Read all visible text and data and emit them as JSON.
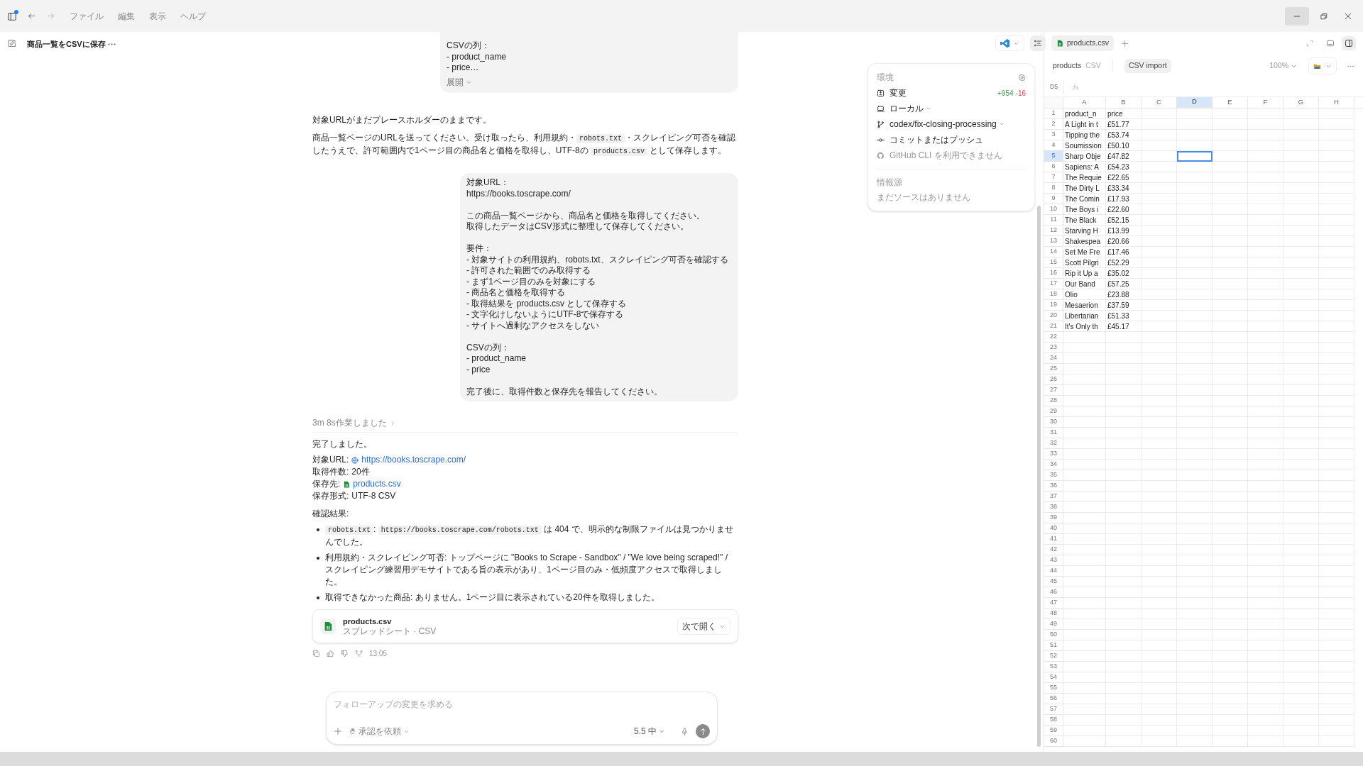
{
  "titlebar": {
    "menus": [
      "ファイル",
      "編集",
      "表示",
      "ヘルプ"
    ]
  },
  "thread": {
    "title": "商品一覧をCSVに保存"
  },
  "messages": [
    {
      "kind": "user",
      "paragraphs": [
        [
          "CSVの列：",
          "- product_name",
          "- price…"
        ]
      ],
      "expand_label": "展開"
    },
    {
      "kind": "assistant",
      "paragraphs": [
        [
          {
            "text": "対象URLがまだプレースホルダーのままです。"
          }
        ],
        [
          {
            "text": "商品一覧ページのURLを送ってください。受け取ったら、利用規約・"
          },
          {
            "code": "robots.txt"
          },
          {
            "text": "・スクレイピング可否を確認したうえで、許可範囲内で1ページ目の商品名と価格を取得し、UTF-8の "
          },
          {
            "code": "products.csv"
          },
          {
            "text": " として保存します。"
          }
        ]
      ]
    },
    {
      "kind": "user",
      "paragraphs": [
        [
          "対象URL：",
          "https://books.toscrape.com/"
        ],
        [
          "この商品一覧ページから、商品名と価格を取得してください。",
          "取得したデータはCSV形式に整理して保存してください。"
        ],
        [
          "要件：",
          "- 対象サイトの利用規約、robots.txt、スクレイピング可否を確認する",
          "- 許可された範囲でのみ取得する",
          "- まず1ページ目のみを対象にする",
          "- 商品名と価格を取得する",
          "- 取得結果を products.csv として保存する",
          "- 文字化けしないようにUTF-8で保存する",
          "- サイトへ過剰なアクセスをしない"
        ],
        [
          "CSVの列：",
          "- product_name",
          "- price"
        ],
        [
          "完了後に、取得件数と保存先を報告してください。"
        ]
      ]
    }
  ],
  "result": {
    "worklog": "3m 8s作業しました",
    "heading": "完了しました。",
    "facts": [
      {
        "kind": "web_link",
        "label": "対象URL:",
        "value": "https://books.toscrape.com/"
      },
      {
        "kind": "plain",
        "label": "取得件数:",
        "value": "20件"
      },
      {
        "kind": "file_link",
        "label": "保存先:",
        "value": "products.csv"
      },
      {
        "kind": "plain",
        "label": "保存形式:",
        "value": "UTF-8 CSV"
      }
    ],
    "checks_heading": "確認結果:",
    "bullets": [
      [
        {
          "code": "robots.txt"
        },
        {
          "text": ": "
        },
        {
          "code": "https://books.toscrape.com/robots.txt"
        },
        {
          "text": " は 404 で、明示的な制限ファイルは見つかりませんでした。"
        }
      ],
      [
        {
          "text": "利用規約・スクレイピング可否: トップページに \"Books to Scrape - Sandbox\" / \"We love being scraped!\" / スクレイピング練習用デモサイトである旨の表示があり、1ページ目のみ・低頻度アクセスで取得しました。"
        }
      ],
      [
        {
          "text": "取得できなかった商品: ありません。1ページ目に表示されている20件を取得しました。"
        }
      ]
    ],
    "attachment": {
      "name": "products.csv",
      "meta": "スプレッドシート · CSV",
      "open_label": "次で開く"
    },
    "time": "13:05"
  },
  "composer": {
    "placeholder": "フォローアップの変更を求める",
    "approval": "承認を依頼",
    "model": "5.5 中"
  },
  "environment": {
    "title": "環境",
    "items": [
      {
        "kind": "changes",
        "label": "変更",
        "added": "+954",
        "removed": "-16",
        "dropdown": false,
        "disabled": false
      },
      {
        "kind": "local",
        "label": "ローカル",
        "dropdown": true,
        "disabled": false
      },
      {
        "kind": "branch",
        "label": "codex/fix-closing-processing",
        "dropdown": true,
        "disabled": false
      },
      {
        "kind": "commit",
        "label": "コミットまたはプッシュ",
        "dropdown": false,
        "disabled": false
      },
      {
        "kind": "github",
        "label": "GitHub CLI を利用できません",
        "dropdown": false,
        "disabled": true
      }
    ],
    "sources_title": "情報源",
    "sources_empty": "まだソースはありません"
  },
  "sheet": {
    "tab": "products.csv",
    "name": "products",
    "type": "CSV",
    "import_label": "CSV import",
    "zoom": "100%",
    "cell_ref": "D5",
    "columns": [
      {
        "label": "A",
        "selected": false
      },
      {
        "label": "B",
        "selected": false
      },
      {
        "label": "C",
        "selected": false
      },
      {
        "label": "D",
        "selected": true
      },
      {
        "label": "E",
        "selected": false
      },
      {
        "label": "F",
        "selected": false
      },
      {
        "label": "G",
        "selected": false
      },
      {
        "label": "H",
        "selected": false
      }
    ],
    "rows": [
      {
        "number": "1",
        "selected": false,
        "cells": [
          "product_n",
          "price"
        ]
      },
      {
        "number": "2",
        "selected": false,
        "cells": [
          "A Light in t",
          "£51.77"
        ]
      },
      {
        "number": "3",
        "selected": false,
        "cells": [
          "Tipping the",
          "£53.74"
        ]
      },
      {
        "number": "4",
        "selected": false,
        "cells": [
          "Soumission",
          "£50.10"
        ]
      },
      {
        "number": "5",
        "selected": true,
        "cells": [
          "Sharp Obje",
          "£47.82"
        ]
      },
      {
        "number": "6",
        "selected": false,
        "cells": [
          "Sapiens: A",
          "£54.23"
        ]
      },
      {
        "number": "7",
        "selected": false,
        "cells": [
          "The Requie",
          "£22.65"
        ]
      },
      {
        "number": "8",
        "selected": false,
        "cells": [
          "The Dirty L",
          "£33.34"
        ]
      },
      {
        "number": "9",
        "selected": false,
        "cells": [
          "The Comin",
          "£17.93"
        ]
      },
      {
        "number": "10",
        "selected": false,
        "cells": [
          "The Boys i",
          "£22.60"
        ]
      },
      {
        "number": "11",
        "selected": false,
        "cells": [
          "The Black",
          "£52.15"
        ]
      },
      {
        "number": "12",
        "selected": false,
        "cells": [
          "Starving H",
          "£13.99"
        ]
      },
      {
        "number": "13",
        "selected": false,
        "cells": [
          "Shakespea",
          "£20.66"
        ]
      },
      {
        "number": "14",
        "selected": false,
        "cells": [
          "Set Me Fre",
          "£17.46"
        ]
      },
      {
        "number": "15",
        "selected": false,
        "cells": [
          "Scott Pilgri",
          "£52.29"
        ]
      },
      {
        "number": "16",
        "selected": false,
        "cells": [
          "Rip it Up a",
          "£35.02"
        ]
      },
      {
        "number": "17",
        "selected": false,
        "cells": [
          "Our Band",
          "£57.25"
        ]
      },
      {
        "number": "18",
        "selected": false,
        "cells": [
          "Olio",
          "£23.88"
        ]
      },
      {
        "number": "19",
        "selected": false,
        "cells": [
          "Mesaerion",
          "£37.59"
        ]
      },
      {
        "number": "20",
        "selected": false,
        "cells": [
          "Libertarian",
          "£51.33"
        ]
      },
      {
        "number": "21",
        "selected": false,
        "cells": [
          "It's Only th",
          "£45.17"
        ]
      },
      {
        "number": "22",
        "selected": false
      },
      {
        "number": "23",
        "selected": false
      },
      {
        "number": "24",
        "selected": false
      },
      {
        "number": "25",
        "selected": false
      },
      {
        "number": "26",
        "selected": false
      },
      {
        "number": "27",
        "selected": false
      },
      {
        "number": "28",
        "selected": false
      },
      {
        "number": "29",
        "selected": false
      },
      {
        "number": "30",
        "selected": false
      },
      {
        "number": "31",
        "selected": false
      },
      {
        "number": "32",
        "selected": false
      },
      {
        "number": "33",
        "selected": false
      },
      {
        "number": "34",
        "selected": false
      },
      {
        "number": "35",
        "selected": false
      },
      {
        "number": "36",
        "selected": false
      },
      {
        "number": "37",
        "selected": false
      },
      {
        "number": "38",
        "selected": false
      },
      {
        "number": "39",
        "selected": false
      },
      {
        "number": "40",
        "selected": false
      },
      {
        "number": "41",
        "selected": false
      },
      {
        "number": "42",
        "selected": false
      },
      {
        "number": "43",
        "selected": false
      },
      {
        "number": "44",
        "selected": false
      },
      {
        "number": "45",
        "selected": false
      },
      {
        "number": "46",
        "selected": false
      },
      {
        "number": "47",
        "selected": false
      },
      {
        "number": "48",
        "selected": false
      },
      {
        "number": "49",
        "selected": false
      },
      {
        "number": "50",
        "selected": false
      },
      {
        "number": "51",
        "selected": false
      },
      {
        "number": "52",
        "selected": false
      },
      {
        "number": "53",
        "selected": false
      },
      {
        "number": "54",
        "selected": false
      },
      {
        "number": "55",
        "selected": false
      },
      {
        "number": "56",
        "selected": false
      },
      {
        "number": "57",
        "selected": false
      },
      {
        "number": "58",
        "selected": false
      },
      {
        "number": "59",
        "selected": false
      },
      {
        "number": "60",
        "selected": false
      }
    ]
  }
}
